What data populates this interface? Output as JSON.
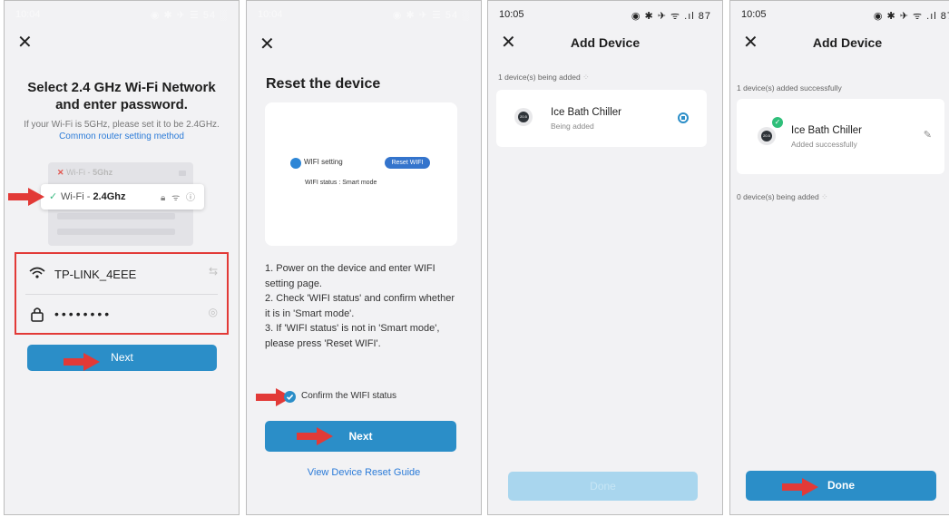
{
  "theme": {
    "accent": "#2b8ec8",
    "arrow": "#e23a37",
    "success": "#2fbf7a",
    "link": "#2b7bd8"
  },
  "screen1": {
    "status": {
      "time": "10:04",
      "icons": "◉ ✱ ✈ ☰ 54 ░"
    },
    "title": "Select 2.4 GHz Wi-Fi Network and enter password.",
    "subtitle": "If your Wi-Fi is 5GHz, please set it to be 2.4GHz.",
    "subtitle_link": "Common router setting method",
    "wifi_5g_prefix": "Wi-Fi - ",
    "wifi_5g_band": "5Ghz",
    "wifi_24_prefix": "Wi-Fi - ",
    "wifi_24_band": "2.4Ghz",
    "ssid": "TP-LINK_4EEE",
    "password_masked": "••••••••",
    "next_label": "Next"
  },
  "screen2": {
    "status": {
      "time": "10:04",
      "icons": "◉ ✱ ✈ ☰ 54 ░"
    },
    "title": "Reset the device",
    "wifi_setting": "WIFI setting",
    "reset_wifi": "Reset WIFI",
    "wifi_status": "WIFI status : Smart mode",
    "steps": [
      "1. Power on the device and enter WIFI setting page.",
      "2. Check 'WIFI status' and confirm whether it is in 'Smart mode'.",
      "3. If 'WIFI status' is not in 'Smart mode', please press 'Reset WIFI'."
    ],
    "confirm_label": "Confirm the WIFI status",
    "next_label": "Next",
    "guide_link": "View Device Reset Guide"
  },
  "screen3": {
    "status": {
      "time": "10:05",
      "icons": "◉ ✱ ✈ ᯤ .ıl 87"
    },
    "title": "Add Device",
    "section": "1 device(s) being added",
    "device_name": "Ice Bath Chiller",
    "device_status": "Being added",
    "device_temp": "20.5",
    "done_label": "Done"
  },
  "screen4": {
    "status": {
      "time": "10:05",
      "icons": "◉ ✱ ✈ ᯤ .ıl 87"
    },
    "title": "Add Device",
    "section_success": "1 device(s) added successfully",
    "device_name": "Ice Bath Chiller",
    "device_status": "Added successfully",
    "device_temp": "20.5",
    "section_pending": "0 device(s) being added",
    "done_label": "Done"
  }
}
